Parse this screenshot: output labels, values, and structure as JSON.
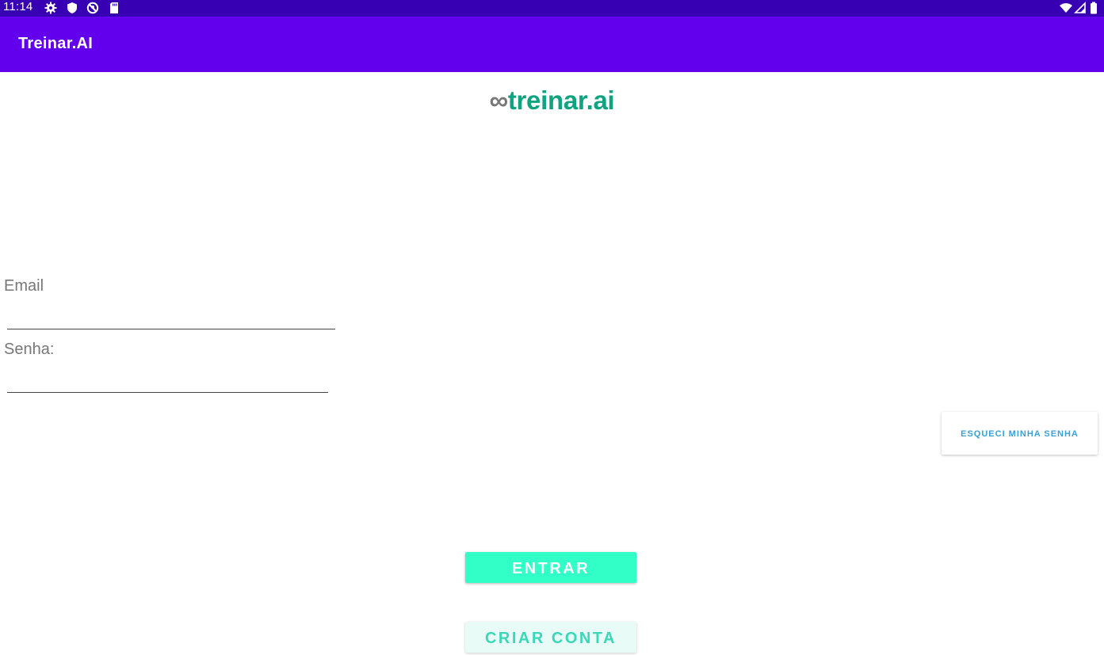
{
  "status_bar": {
    "time": "11:14",
    "left_icons": [
      "gear-icon",
      "shield-icon",
      "no-location-icon",
      "sd-card-icon"
    ],
    "right_icons": [
      "wifi-icon",
      "signal-icon",
      "battery-icon"
    ]
  },
  "app_bar": {
    "title": "Treinar.AI"
  },
  "logo": {
    "symbol": "∞",
    "text": "treinar.ai"
  },
  "form": {
    "email_label": "Email",
    "email_value": "",
    "password_label": "Senha:",
    "password_value": ""
  },
  "buttons": {
    "forgot_password": "ESQUECI MINHA SENHA",
    "enter": "ENTRAR",
    "create_account": "CRIAR CONTA"
  },
  "colors": {
    "status_bar": "#3700b3",
    "app_bar": "#6200ee",
    "logo_green": "#0fa37f",
    "logo_gray": "#777777",
    "primary_button": "#32ffc8",
    "link_blue": "#3ba0d6"
  }
}
